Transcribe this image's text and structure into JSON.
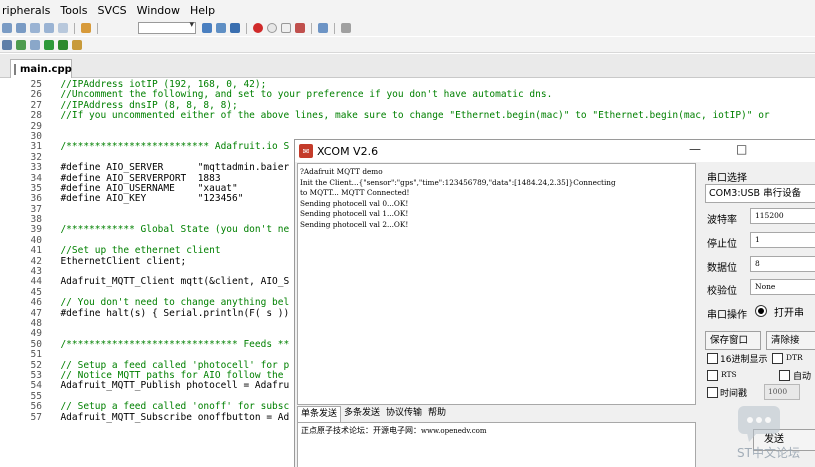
{
  "ide": {
    "menu": [
      "ripherals",
      "Tools",
      "SVCS",
      "Window",
      "Help"
    ],
    "file_tab": "main.cpp",
    "lines": [
      {
        "n": "25",
        "t": "  //IPAddress iotIP (192, 168, 0, 42);"
      },
      {
        "n": "26",
        "t": "  //Uncomment the following, and set to your preference if you don't have automatic dns."
      },
      {
        "n": "27",
        "t": "  //IPAddress dnsIP (8, 8, 8, 8);"
      },
      {
        "n": "28",
        "t": "  //If you uncommented either of the above lines, make sure to change \"Ethernet.begin(mac)\" to \"Ethernet.begin(mac, iotIP)\" or"
      },
      {
        "n": "29",
        "t": ""
      },
      {
        "n": "30",
        "t": ""
      },
      {
        "n": "31",
        "t": "  /************************* Adafruit.io S"
      },
      {
        "n": "32",
        "t": ""
      },
      {
        "n": "33",
        "t": "  #define AIO_SERVER      \"mqttadmin.baier"
      },
      {
        "n": "34",
        "t": "  #define AIO_SERVERPORT  1883"
      },
      {
        "n": "35",
        "t": "  #define AIO_USERNAME    \"xauat\""
      },
      {
        "n": "36",
        "t": "  #define AIO_KEY         \"123456\""
      },
      {
        "n": "37",
        "t": ""
      },
      {
        "n": "38",
        "t": ""
      },
      {
        "n": "39",
        "t": "  /************ Global State (you don't ne"
      },
      {
        "n": "40",
        "t": ""
      },
      {
        "n": "41",
        "t": "  //Set up the ethernet client"
      },
      {
        "n": "42",
        "t": "  EthernetClient client;"
      },
      {
        "n": "43",
        "t": ""
      },
      {
        "n": "44",
        "t": "  Adafruit_MQTT_Client mqtt(&client, AIO_S"
      },
      {
        "n": "45",
        "t": ""
      },
      {
        "n": "46",
        "t": "  // You don't need to change anything bel"
      },
      {
        "n": "47",
        "t": "  #define halt(s) { Serial.println(F( s ))"
      },
      {
        "n": "48",
        "t": ""
      },
      {
        "n": "49",
        "t": ""
      },
      {
        "n": "50",
        "t": "  /****************************** Feeds **"
      },
      {
        "n": "51",
        "t": ""
      },
      {
        "n": "52",
        "t": "  // Setup a feed called 'photocell' for p"
      },
      {
        "n": "53",
        "t": "  // Notice MQTT paths for AIO follow the "
      },
      {
        "n": "54",
        "t": "  Adafruit_MQTT_Publish photocell = Adafru"
      },
      {
        "n": "55",
        "t": ""
      },
      {
        "n": "56",
        "t": "  // Setup a feed called 'onoff' for subsc"
      },
      {
        "n": "57",
        "t": "  Adafruit_MQTT_Subscribe onoffbutton = Ad"
      }
    ]
  },
  "xcom": {
    "title": "XCOM V2.6",
    "minimize": "—",
    "maximize": "□",
    "receive_lines": [
      "?Adafruit MQTT demo",
      "Init the Client...{\"sensor\":\"gps\",\"time\":123456789,\"data\":[1484.24,2.35]}Connecting",
      "to MQTT... MQTT Connected!",
      "Sending photocell val 0...OK!",
      "Sending photocell val 1...OK!",
      "Sending photocell val 2...OK!"
    ],
    "port_section_label": "串口选择",
    "port_value": "COM3:USB 串行设备",
    "baud_label": "波特率",
    "baud_value": "115200",
    "stopbits_label": "停止位",
    "stopbits_value": "1",
    "databits_label": "数据位",
    "databits_value": "8",
    "parity_label": "校验位",
    "parity_value": "None",
    "port_op_label": "串口操作",
    "open_label": "打开串",
    "save_window": "保存窗口",
    "clear_receive": "清除接",
    "hex_display": "16进制显示",
    "dtr": "DTR",
    "rts": "RTS",
    "auto_label": "自动",
    "timed_send": "时间戳",
    "interval_value": "1000",
    "send_tabs": [
      "单条发送",
      "多条发送",
      "协议传输",
      "帮助"
    ],
    "send_text_cn": "正点原子技术论坛：开源电子网：",
    "send_text_en": "www.openedv.com",
    "send_button": "发送"
  },
  "watermark": "ST中文论坛"
}
